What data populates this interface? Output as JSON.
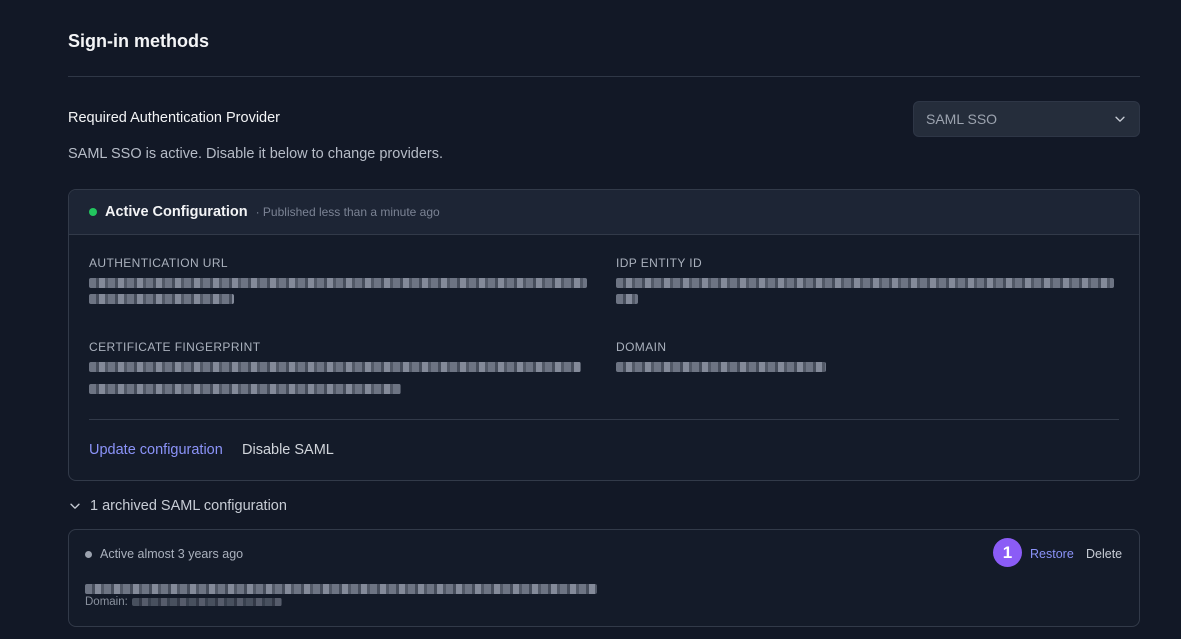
{
  "section": {
    "title": "Sign-in methods"
  },
  "provider": {
    "label": "Required Authentication Provider",
    "selected": "SAML SSO",
    "help": "SAML SSO is active. Disable it below to change providers."
  },
  "active_config": {
    "title": "Active Configuration",
    "subtitle": "· Published less than a minute ago",
    "fields": {
      "auth_url_label": "Authentication URL",
      "idp_entity_label": "IdP Entity ID",
      "cert_label": "Certificate Fingerprint",
      "domain_label": "Domain"
    },
    "update_label": "Update configuration",
    "disable_label": "Disable SAML"
  },
  "archived": {
    "toggle_label": "1 archived SAML configuration",
    "item": {
      "status": "Active almost 3 years ago",
      "badge": "1",
      "restore_label": "Restore",
      "delete_label": "Delete",
      "domain_label": "Domain:"
    }
  },
  "colors": {
    "accent": "#8b93f8",
    "active_dot": "#22c55e",
    "badge": "#8b5cf6"
  }
}
